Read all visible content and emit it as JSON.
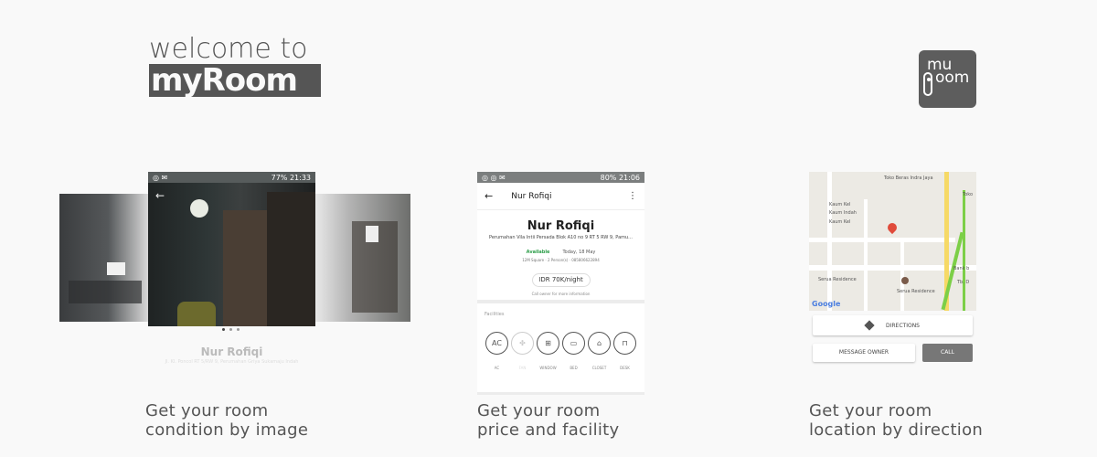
{
  "header": {
    "title_line1": "welcome to",
    "title_line2": "myRoom",
    "logo_text_top": "mu",
    "logo_text_bottom": "oom"
  },
  "captions": [
    {
      "line1": "Get your room",
      "line2": "condition by image"
    },
    {
      "line1": "Get your room",
      "line2": "price and facility"
    },
    {
      "line1": "Get your room",
      "line2": "location by direction"
    }
  ],
  "panel1": {
    "status_time": "21:33",
    "status_battery": "77%",
    "room_name": "Nur Rofiqi",
    "room_address": "Jl. Kl. Poncol RT 5/RW 9, Perumahan Griya Sukamaju Indah",
    "carousel_dots": 3,
    "carousel_active": 1
  },
  "panel2": {
    "status_time": "21:06",
    "status_battery": "80%",
    "toolbar_title": "Nur Rofiqi",
    "room_name": "Nur Rofiqi",
    "room_address": "Perumahan Vila Intii Persada Blok A10 no 9 RT 5 RW 9, Pamu...",
    "availability": "Available",
    "date": "Today, 18 May",
    "meta": "12M Square  ·  2 Person(s)  ·  085806622894",
    "price": "IDR 70K/night",
    "call_hint": "Call owner for more information",
    "facilities_title": "Facilities",
    "facilities": [
      {
        "label": "AC",
        "icon": "ac-icon",
        "available": true
      },
      {
        "label": "FAN",
        "icon": "fan-icon",
        "available": false
      },
      {
        "label": "WINDOW",
        "icon": "window-icon",
        "available": true
      },
      {
        "label": "BED",
        "icon": "bed-icon",
        "available": true
      },
      {
        "label": "CLOSET",
        "icon": "hanger-icon",
        "available": true
      },
      {
        "label": "DESK",
        "icon": "desk-icon",
        "available": true
      }
    ]
  },
  "panel3": {
    "map_labels": {
      "toko_beras": "Toko Beras Indra Jaya",
      "toko": "Toko",
      "kaum_kel": "Kaum Kel",
      "kaum_indah": "Kaum Indah",
      "kaum_kel2": "Kaum Kel",
      "bank": "Bank b",
      "tb": "Tb. D",
      "serua_res": "Serua Residence",
      "serua_res2": "Serua Residence",
      "google": "Google"
    },
    "directions_label": "DIRECTIONS",
    "message_label": "MESSAGE OWNER",
    "call_label": "CALL"
  },
  "colors": {
    "background": "#f9f9f9",
    "text": "#555555",
    "available_green": "#2e9e4a",
    "pin_red": "#e04b3b",
    "call_button": "#777777"
  }
}
